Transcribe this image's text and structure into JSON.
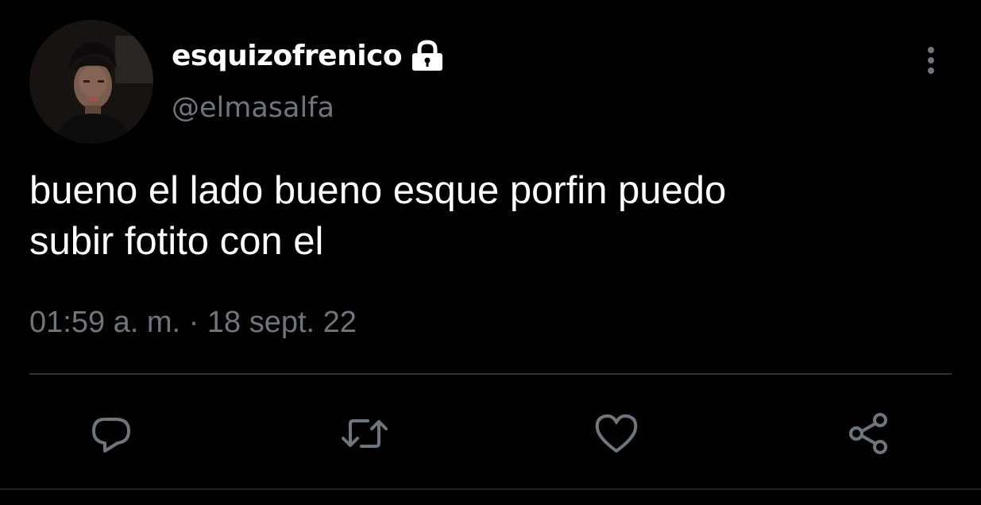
{
  "tweet": {
    "author": {
      "display_name": "esquizofrenico",
      "handle": "@elmasalfa",
      "protected_icon": "lock-icon",
      "avatar": "profile-photo"
    },
    "text_lines": [
      "bueno el lado bueno esque porfin puedo",
      "subir fotito con el"
    ],
    "timestamp": "01:59 a. m. · 18 sept. 22",
    "more_icon": "more-vertical-icon"
  },
  "actions": {
    "reply_icon": "reply-icon",
    "retweet_icon": "retweet-icon",
    "like_icon": "heart-icon",
    "share_icon": "share-icon"
  },
  "colors": {
    "background": "#000000",
    "text_primary": "#ffffff",
    "text_secondary": "#6e767d",
    "divider": "#2f3336"
  }
}
